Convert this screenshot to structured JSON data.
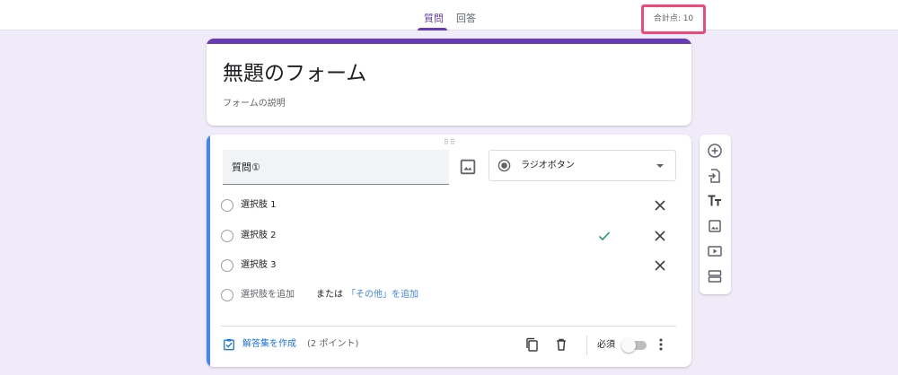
{
  "header": {
    "tabs": [
      {
        "label": "質問",
        "active": true
      },
      {
        "label": "回答",
        "active": false
      }
    ],
    "total_points": "合計点: 10"
  },
  "form": {
    "title": "無題のフォーム",
    "description": "フォームの説明"
  },
  "question": {
    "title": "質問①",
    "type": "ラジオボタン",
    "options": [
      {
        "label": "選択肢 1",
        "correct": false
      },
      {
        "label": "選択肢 2",
        "correct": true
      },
      {
        "label": "選択肢 3",
        "correct": false
      }
    ],
    "add_option": "選択肢を追加",
    "or_text": "または",
    "add_other": "「その他」を追加",
    "answer_key": "解答集を作成",
    "points": "(2 ポイント)",
    "required_label": "必須",
    "required": false
  },
  "toolbar": {
    "items": [
      "add-question-icon",
      "import-questions-icon",
      "add-title-icon",
      "add-image-icon",
      "add-video-icon",
      "add-section-icon"
    ]
  },
  "colors": {
    "accent": "#673ab7",
    "active_card": "#4285f4",
    "highlight": "#f2477a",
    "check": "#0f9d58"
  }
}
